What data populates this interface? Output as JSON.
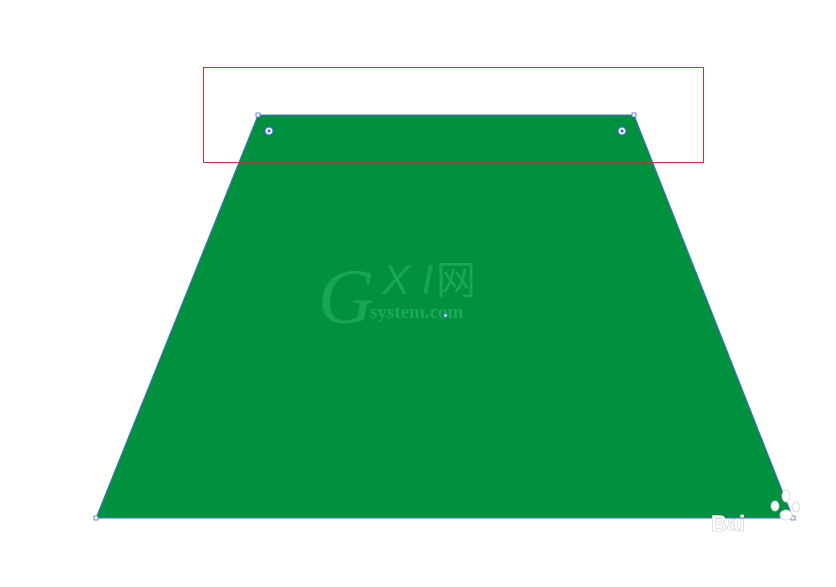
{
  "canvas": {
    "background": "#ffffff"
  },
  "shape": {
    "kind": "trapezoid",
    "fill_color": "#00913f",
    "outline_color": "#4a6fd8",
    "anchor_icon": "anchor-point-icon",
    "corner_widget_icon": "live-corner-widget-icon",
    "center_point_icon": "center-point-icon"
  },
  "selection_box": {
    "stroke_color": "#c0393b"
  },
  "watermark": {
    "logo_letter": "G",
    "logo_xi": "X I",
    "logo_net": "网",
    "logo_domain": "system.com",
    "color": "#2fb56a"
  },
  "corner_watermark": {
    "text": "Bai",
    "icon": "paw-icon"
  }
}
